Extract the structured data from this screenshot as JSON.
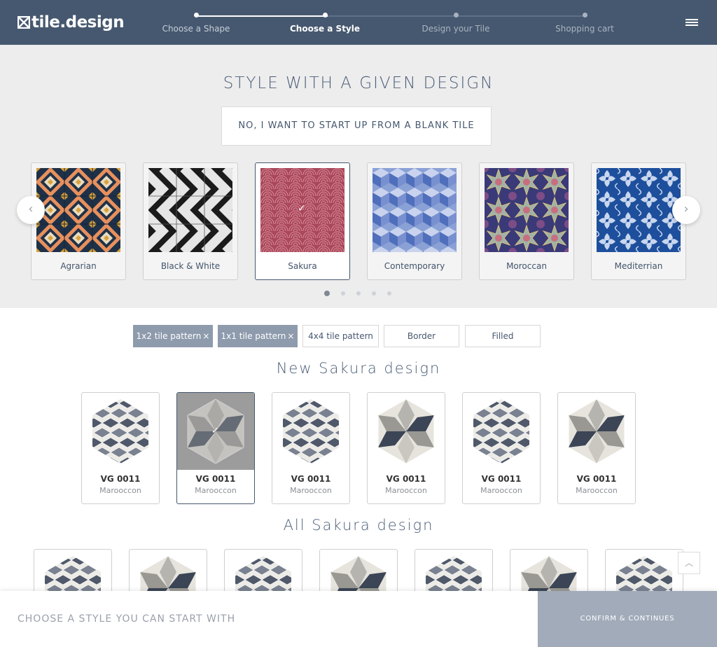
{
  "brand": {
    "name": "tile.design"
  },
  "steps": [
    {
      "label": "Choose a Shape",
      "state": "done"
    },
    {
      "label": "Choose a Style",
      "state": "active"
    },
    {
      "label": "Design your Tile",
      "state": "todo"
    },
    {
      "label": "Shopping cart",
      "state": "todo"
    }
  ],
  "style_section": {
    "title": "STYLE WITH A GIVEN DESIGN",
    "blank_button": "NO, I WANT TO START UP FROM A BLANK TILE",
    "prev_icon": "chevron-left-icon",
    "next_icon": "chevron-right-icon",
    "styles": [
      {
        "name": "Agrarian",
        "selected": false
      },
      {
        "name": "Black & White",
        "selected": false
      },
      {
        "name": "Sakura",
        "selected": true
      },
      {
        "name": "Contemporary",
        "selected": false
      },
      {
        "name": "Moroccan",
        "selected": false
      },
      {
        "name": "Mediterrian",
        "selected": false
      }
    ],
    "page_count": 5,
    "current_page": 1
  },
  "filters": [
    {
      "label": "1x2 tile pattern",
      "active": true,
      "remove": "×"
    },
    {
      "label": "1x1 tile pattern",
      "active": true,
      "remove": "×"
    },
    {
      "label": "4x4 tile pattern",
      "active": false
    },
    {
      "label": "Border",
      "active": false
    },
    {
      "label": "Filled",
      "active": false
    }
  ],
  "new_designs": {
    "title": "New Sakura design",
    "items": [
      {
        "code": "VG 0011",
        "sub": "Marooccon",
        "pattern": "small",
        "selected": false
      },
      {
        "code": "VG 0011",
        "sub": "Marooccon",
        "pattern": "large",
        "selected": true
      },
      {
        "code": "VG 0011",
        "sub": "Marooccon",
        "pattern": "small",
        "selected": false
      },
      {
        "code": "VG 0011",
        "sub": "Marooccon",
        "pattern": "large",
        "selected": false
      },
      {
        "code": "VG 0011",
        "sub": "Marooccon",
        "pattern": "small",
        "selected": false
      },
      {
        "code": "VG 0011",
        "sub": "Marooccon",
        "pattern": "large",
        "selected": false
      }
    ]
  },
  "all_designs": {
    "title": "All Sakura design",
    "patterns": [
      "small",
      "large",
      "small",
      "large",
      "small",
      "large",
      "small"
    ]
  },
  "footer": {
    "message": "CHOOSE A STYLE YOU CAN START WITH",
    "confirm": "CONFIRM & CONTINUES"
  },
  "colors": {
    "header": "#46586f",
    "accent": "#a1abb9",
    "filter_active": "#8e9bad"
  }
}
